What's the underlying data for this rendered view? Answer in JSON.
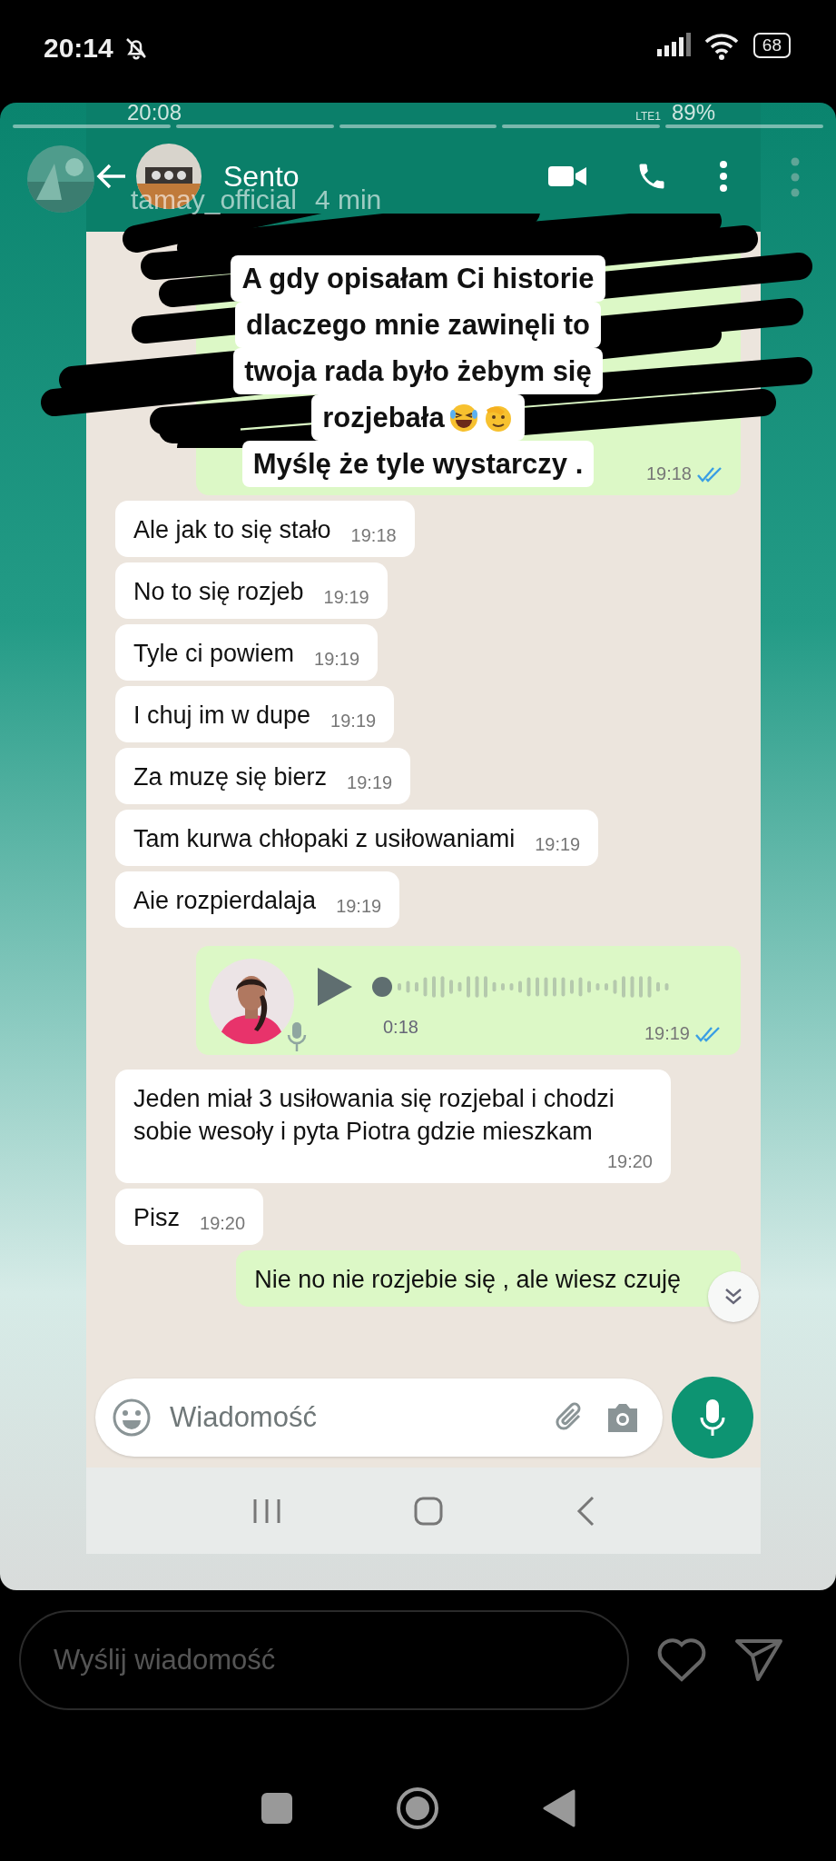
{
  "status_bar": {
    "time": "20:14",
    "battery": "68"
  },
  "story": {
    "user": "tamay_official",
    "time": "4 min"
  },
  "screenshot": {
    "status_bar": {
      "time": "20:08",
      "network": "LTE1",
      "battery": "89%"
    },
    "chat": {
      "contact": "Sento"
    },
    "messages": [
      {
        "kind": "covered",
        "outgoing": true,
        "time": "19:18",
        "read": true
      },
      {
        "kind": "text",
        "outgoing": false,
        "text": "Ale jak to się stało",
        "time": "19:18"
      },
      {
        "kind": "text",
        "outgoing": false,
        "text": "No to się rozjeb",
        "time": "19:19"
      },
      {
        "kind": "text",
        "outgoing": false,
        "text": "Tyle ci powiem",
        "time": "19:19"
      },
      {
        "kind": "text",
        "outgoing": false,
        "text": "I chuj im w dupe",
        "time": "19:19"
      },
      {
        "kind": "text",
        "outgoing": false,
        "text": "Za muzę się bierz",
        "time": "19:19"
      },
      {
        "kind": "text",
        "outgoing": false,
        "text": "Tam kurwa chłopaki z usiłowaniami",
        "time": "19:19"
      },
      {
        "kind": "text",
        "outgoing": false,
        "text": "Aie rozpierdalaja",
        "time": "19:19"
      },
      {
        "kind": "voice",
        "outgoing": true,
        "duration": "0:18",
        "time": "19:19",
        "read": true
      },
      {
        "kind": "text",
        "outgoing": false,
        "text": "Jeden miał 3 usiłowania się rozjebal i chodzi sobie wesoły i pyta Piotra gdzie mieszkam",
        "time": "19:20"
      },
      {
        "kind": "text",
        "outgoing": false,
        "text": "Pisz",
        "time": "19:20"
      },
      {
        "kind": "text",
        "outgoing": true,
        "text": "Nie no nie rozjebie się , ale wiesz czuję"
      }
    ],
    "input": {
      "placeholder": "Wiadomość"
    }
  },
  "sticker": {
    "lines": [
      {
        "kind": "plain",
        "text": "A gdy opisałam Ci historie"
      },
      {
        "kind": "plain",
        "text": "dlaczego mnie zawinęli to"
      },
      {
        "kind": "plain",
        "text": "twoja rada było żebym się"
      },
      {
        "kind": "with_emoji",
        "text": "rozjebała"
      },
      {
        "kind": "plain",
        "text": "Myślę że tyle wystarczy ."
      }
    ]
  },
  "reply": {
    "placeholder": "Wyślij wiadomość"
  }
}
